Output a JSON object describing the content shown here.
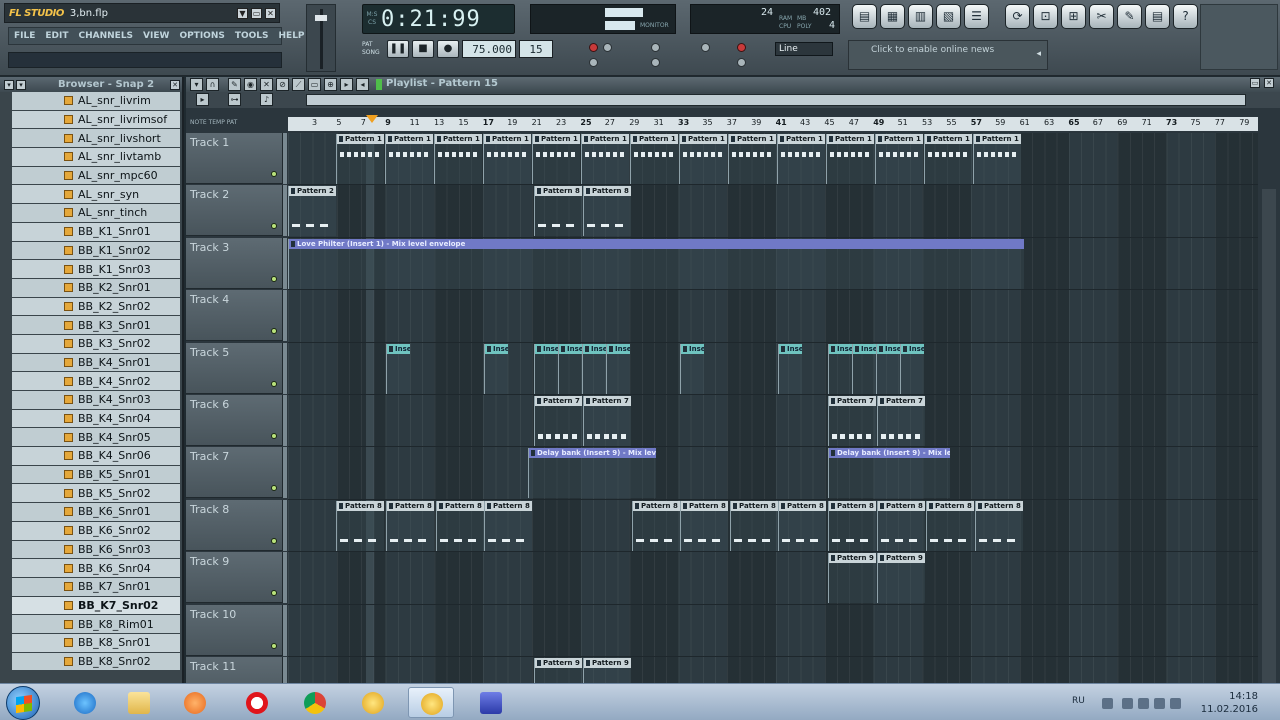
{
  "app": {
    "logo": "FL STUDIO",
    "filename": "3,bn.flp",
    "win_buttons": [
      "▼",
      "▭",
      "✕"
    ],
    "menu": [
      "FILE",
      "EDIT",
      "CHANNELS",
      "VIEW",
      "OPTIONS",
      "TOOLS",
      "HELP"
    ]
  },
  "transport": {
    "time": "0:21:99",
    "time_units": [
      "M:S",
      "CS"
    ],
    "tempo": "75.000",
    "pattern": "15",
    "pat_label": "PAT",
    "song_label": "SONG",
    "play_icon": "❚❚",
    "stop_icon": "■",
    "record_icon": "●",
    "snap": "Line",
    "monitor_label": "MONITOR",
    "cpu": {
      "ram": "402",
      "value_top": "24",
      "poly": "4",
      "ram_label": "RAM",
      "cpu_label": "CPU",
      "poly_label": "POLY",
      "mb_label": "MB"
    }
  },
  "news": {
    "text": "Click to enable online news",
    "arrow": "◂"
  },
  "tool_icons_left": [
    "▤",
    "▦",
    "▥",
    "▧",
    "☰"
  ],
  "tool_icons_right": [
    "⟳",
    "⊡",
    "⊞",
    "✂",
    "✎",
    "▤",
    "?"
  ],
  "browser": {
    "title": "Browser - Snap 2",
    "close": "✕",
    "items": [
      "AL_snr_livrim",
      "AL_snr_livrimsof",
      "AL_snr_livshort",
      "AL_snr_livtamb",
      "AL_snr_mpc60",
      "AL_snr_syn",
      "AL_snr_tinch",
      "BB_K1_Snr01",
      "BB_K1_Snr02",
      "BB_K1_Snr03",
      "BB_K2_Snr01",
      "BB_K2_Snr02",
      "BB_K3_Snr01",
      "BB_K3_Snr02",
      "BB_K4_Snr01",
      "BB_K4_Snr02",
      "BB_K4_Snr03",
      "BB_K4_Snr04",
      "BB_K4_Snr05",
      "BB_K4_Snr06",
      "BB_K5_Snr01",
      "BB_K5_Snr02",
      "BB_K6_Snr01",
      "BB_K6_Snr02",
      "BB_K6_Snr03",
      "BB_K6_Snr04",
      "BB_K7_Snr01",
      "BB_K7_Snr02",
      "BB_K8_Rim01",
      "BB_K8_Snr01",
      "BB_K8_Snr02"
    ],
    "selected": "BB_K7_Snr02"
  },
  "playlist": {
    "title": "Playlist - Pattern 15",
    "sub_labels": "NOTE  TEMP  PAT",
    "ticks": [
      "3",
      "5",
      "7",
      "9",
      "11",
      "13",
      "15",
      "17",
      "19",
      "21",
      "23",
      "25",
      "27",
      "29",
      "31",
      "33",
      "35",
      "37",
      "39",
      "41",
      "43",
      "45",
      "47",
      "49",
      "51",
      "53",
      "55",
      "57",
      "59",
      "61",
      "63",
      "65",
      "67",
      "69",
      "71",
      "73",
      "75",
      "77",
      "79"
    ],
    "tracks": [
      "Track 1",
      "Track 2",
      "Track 3",
      "Track 4",
      "Track 5",
      "Track 6",
      "Track 7",
      "Track 8",
      "Track 9",
      "Track 10",
      "Track 11"
    ],
    "clip_labels": {
      "pattern1": "Pattern 1",
      "pattern2": "Pattern 2",
      "pattern7": "Pattern 7",
      "pattern8": "Pattern 8",
      "pattern9": "Pattern 9",
      "love_philter": "Love Philter (Insert 1) - Mix level envelope",
      "delay_bank": "Delay bank (Insert 9) - Mix lev...",
      "insert": "Insert..."
    }
  },
  "taskbar": {
    "lang": "RU",
    "time": "14:18",
    "date": "11.02.2016"
  }
}
